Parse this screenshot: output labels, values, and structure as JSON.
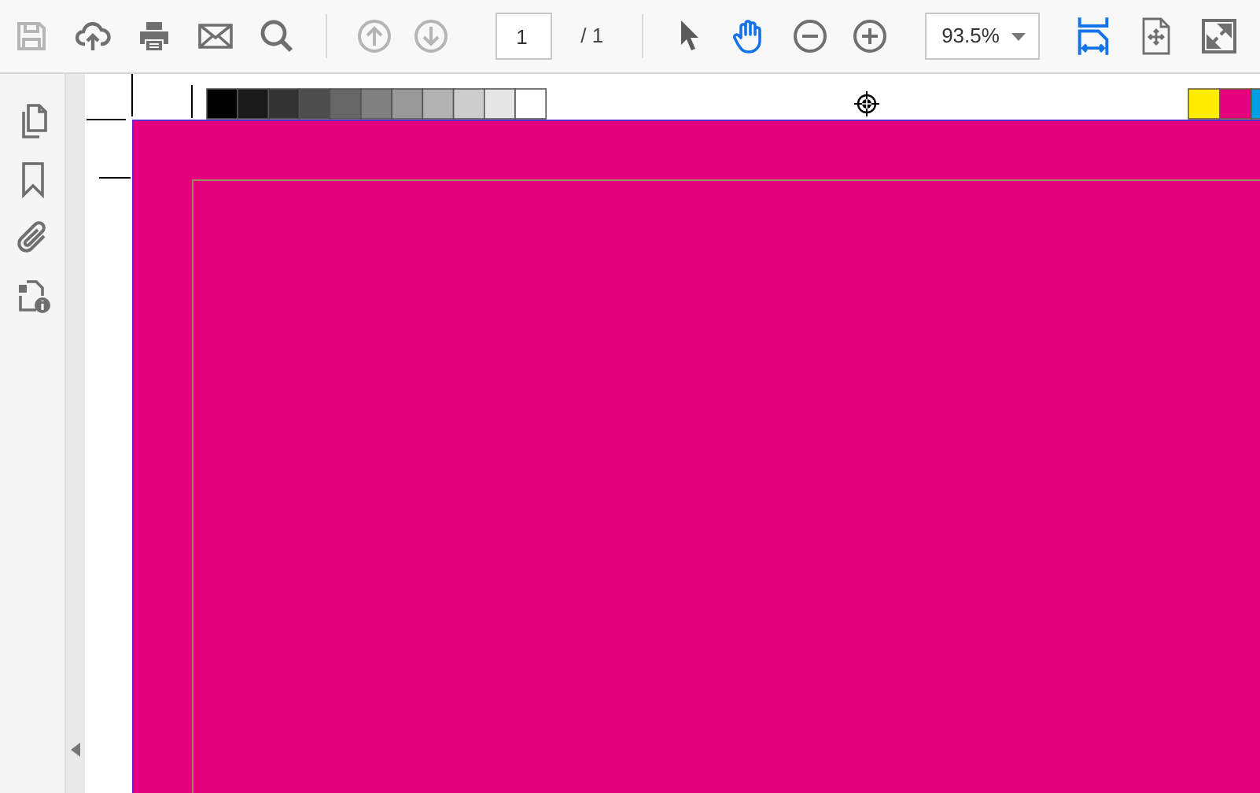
{
  "toolbar": {
    "tools_left": [
      {
        "kind": "save",
        "disabled": true
      },
      {
        "kind": "upload",
        "disabled": false
      },
      {
        "kind": "print",
        "disabled": false
      },
      {
        "kind": "email",
        "disabled": false
      },
      {
        "kind": "search",
        "disabled": false
      }
    ],
    "nav_tools": [
      {
        "kind": "prev",
        "disabled": true
      },
      {
        "kind": "next",
        "disabled": true
      }
    ],
    "page_field": {
      "value": "1",
      "total": "/ 1"
    },
    "tools_mid": [
      {
        "kind": "select",
        "selected": false
      },
      {
        "kind": "hand",
        "selected": true
      },
      {
        "kind": "zoom-out",
        "selected": false
      },
      {
        "kind": "zoom-in",
        "selected": false
      }
    ],
    "zoom_field": {
      "value": "93.5%"
    },
    "tools_right": [
      {
        "kind": "fit-width",
        "selected": true
      },
      {
        "kind": "fit-page",
        "selected": false
      },
      {
        "kind": "fullscreen",
        "selected": false
      }
    ]
  },
  "sidebar": {
    "items": [
      {
        "kind": "pages"
      },
      {
        "kind": "bookmarks"
      },
      {
        "kind": "attachments"
      },
      {
        "kind": "info"
      }
    ]
  },
  "document": {
    "gray_scale": [
      {
        "color": "#000000"
      },
      {
        "color": "#1a1a1a"
      },
      {
        "color": "#333333"
      },
      {
        "color": "#4d4d4d"
      },
      {
        "color": "#666666"
      },
      {
        "color": "#808080"
      },
      {
        "color": "#999999"
      },
      {
        "color": "#b3b3b3"
      },
      {
        "color": "#cccccc"
      },
      {
        "color": "#e6e6e6"
      },
      {
        "color": "#ffffff"
      }
    ],
    "color_bar": [
      {
        "color": "#ffed00"
      },
      {
        "color": "#e5007d"
      },
      {
        "color": "#009fe3"
      }
    ]
  }
}
